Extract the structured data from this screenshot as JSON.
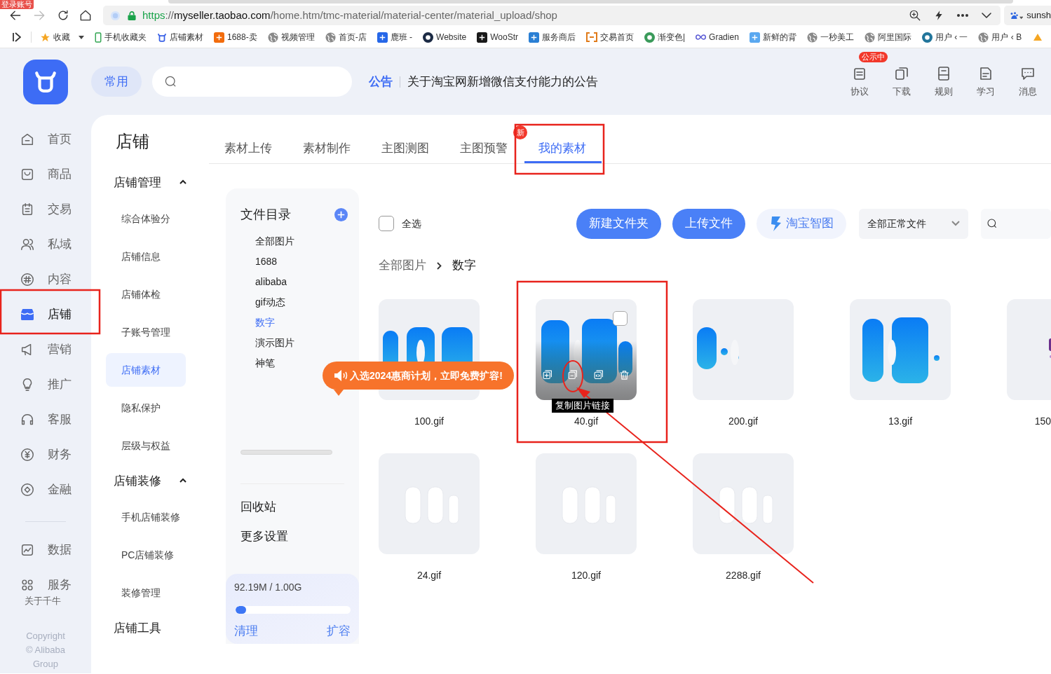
{
  "browser": {
    "badge": "登录账号",
    "url": {
      "scheme": "https",
      "rest": "://",
      "host": "myseller.taobao.com",
      "path": "/home.htm/tmc-material/material-center/material_upload/shop"
    },
    "profile": "sunsh",
    "bookmarks": [
      {
        "label": "收藏",
        "kind": "star",
        "menu": true
      },
      {
        "label": "手机收藏夹",
        "kind": "phone"
      },
      {
        "label": "店铺素材",
        "kind": "cow"
      },
      {
        "label": "1688-卖",
        "kind": "tile",
        "color": "#f26c0d"
      },
      {
        "label": "视频管理",
        "kind": "globe"
      },
      {
        "label": "首页-店",
        "kind": "globe"
      },
      {
        "label": "鹿班 -",
        "kind": "tile",
        "color": "#2667e8"
      },
      {
        "label": "Website",
        "kind": "dot",
        "color": "#1b2a44"
      },
      {
        "label": "WooStr",
        "kind": "tile",
        "color": "#1a1a1a"
      },
      {
        "label": "服务商后",
        "kind": "tile",
        "color": "#2a7fd4"
      },
      {
        "label": "交易首页",
        "kind": "bracket",
        "color": "#e07b1a"
      },
      {
        "label": "渐变色|",
        "kind": "dot",
        "color": "#3a9a5a"
      },
      {
        "label": "Gradien",
        "kind": "loop",
        "color": "#5b5bd6"
      },
      {
        "label": "新鲜的背",
        "kind": "tile",
        "color": "#5aa8f0"
      },
      {
        "label": "一秒美工",
        "kind": "globe"
      },
      {
        "label": "阿里国际",
        "kind": "globe"
      },
      {
        "label": "用户 ‹ 一",
        "kind": "dot",
        "color": "#21759b"
      },
      {
        "label": "用户 ‹ B",
        "kind": "globe"
      }
    ]
  },
  "header": {
    "shortcut": "常用",
    "notice_label": "公告",
    "notice": "关于淘宝网新增微信支付能力的公告",
    "tools": [
      {
        "label": "协议",
        "kind": "doc",
        "badge": "公示中"
      },
      {
        "label": "下载",
        "kind": "copy"
      },
      {
        "label": "规则",
        "kind": "rules"
      },
      {
        "label": "学习",
        "kind": "learn"
      },
      {
        "label": "消息",
        "kind": "chat"
      }
    ]
  },
  "nav": {
    "items": [
      {
        "label": "首页",
        "kind": "home",
        "selected": false
      },
      {
        "label": "商品",
        "kind": "bag",
        "selected": false
      },
      {
        "label": "交易",
        "kind": "clipboard",
        "selected": false
      },
      {
        "label": "私域",
        "kind": "people",
        "selected": false
      },
      {
        "label": "内容",
        "kind": "hash",
        "selected": false
      },
      {
        "label": "店铺",
        "kind": "store",
        "selected": true
      },
      {
        "label": "营销",
        "kind": "megaphone",
        "selected": false
      },
      {
        "label": "推广",
        "kind": "bulb",
        "selected": false
      },
      {
        "label": "客服",
        "kind": "headset",
        "selected": false
      },
      {
        "label": "财务",
        "kind": "yen",
        "selected": false
      },
      {
        "label": "金融",
        "kind": "diamond",
        "selected": false
      }
    ],
    "bottom_items": [
      {
        "label": "数据",
        "kind": "chart",
        "selected": false
      },
      {
        "label": "服务",
        "kind": "apps",
        "selected": false
      }
    ],
    "about": "关于千牛",
    "copyright": [
      "Copyright",
      "© Alibaba",
      "Group"
    ]
  },
  "subnav": {
    "title": "店铺",
    "groups": [
      {
        "label": "店铺管理",
        "expanded": true,
        "items": [
          {
            "label": "综合体验分",
            "selected": false
          },
          {
            "label": "店铺信息",
            "selected": false
          },
          {
            "label": "店铺体检",
            "selected": false
          },
          {
            "label": "子账号管理",
            "selected": false
          },
          {
            "label": "店铺素材",
            "selected": true
          },
          {
            "label": "隐私保护",
            "selected": false
          },
          {
            "label": "层级与权益",
            "selected": false
          }
        ]
      },
      {
        "label": "店铺装修",
        "expanded": true,
        "items": [
          {
            "label": "手机店铺装修",
            "selected": false
          },
          {
            "label": "PC店铺装修",
            "selected": false
          },
          {
            "label": "装修管理",
            "selected": false
          }
        ]
      },
      {
        "label": "店铺工具"
      }
    ]
  },
  "tabs": [
    {
      "label": "素材上传",
      "selected": false
    },
    {
      "label": "素材制作",
      "selected": false
    },
    {
      "label": "主图测图",
      "selected": false
    },
    {
      "label": "主图预警",
      "selected": false,
      "badge": "新"
    },
    {
      "label": "我的素材",
      "selected": true
    }
  ],
  "folders": {
    "title": "文件目录",
    "items": [
      {
        "label": "全部图片",
        "selected": false
      },
      {
        "label": "1688",
        "selected": false
      },
      {
        "label": "alibaba",
        "selected": false
      },
      {
        "label": "gif动态",
        "selected": false
      },
      {
        "label": "数字",
        "selected": true
      },
      {
        "label": "演示图片",
        "selected": false
      },
      {
        "label": "神笔",
        "selected": false
      }
    ],
    "extra": [
      "回收站",
      "更多设置"
    ],
    "storage": {
      "usage": "92.19M / 1.00G",
      "level": 0.09,
      "actions": [
        "清理",
        "扩容"
      ]
    }
  },
  "promo": "入选2024惠商计划，立即免费扩容!",
  "toolbar": {
    "select_all": {
      "label": "全选",
      "checked": false
    },
    "buttons": [
      {
        "label": "新建文件夹",
        "kind": "primary"
      },
      {
        "label": "上传文件",
        "kind": "primary"
      },
      {
        "label": "淘宝智图",
        "kind": "brand"
      }
    ],
    "filter": "全部正常文件"
  },
  "breadcrumb": [
    "全部图片",
    "数字"
  ],
  "files": [
    {
      "name": "100.gif",
      "hovered": false
    },
    {
      "name": "40.gif",
      "hovered": true,
      "checked": false,
      "tooltip": "复制图片链接"
    },
    {
      "name": "200.gif",
      "hovered": false
    },
    {
      "name": "13.gif",
      "hovered": false
    },
    {
      "name": "150",
      "hovered": false
    },
    {
      "name": "24.gif",
      "hovered": false
    },
    {
      "name": "120.gif",
      "hovered": false
    },
    {
      "name": "2288.gif",
      "hovered": false
    }
  ]
}
